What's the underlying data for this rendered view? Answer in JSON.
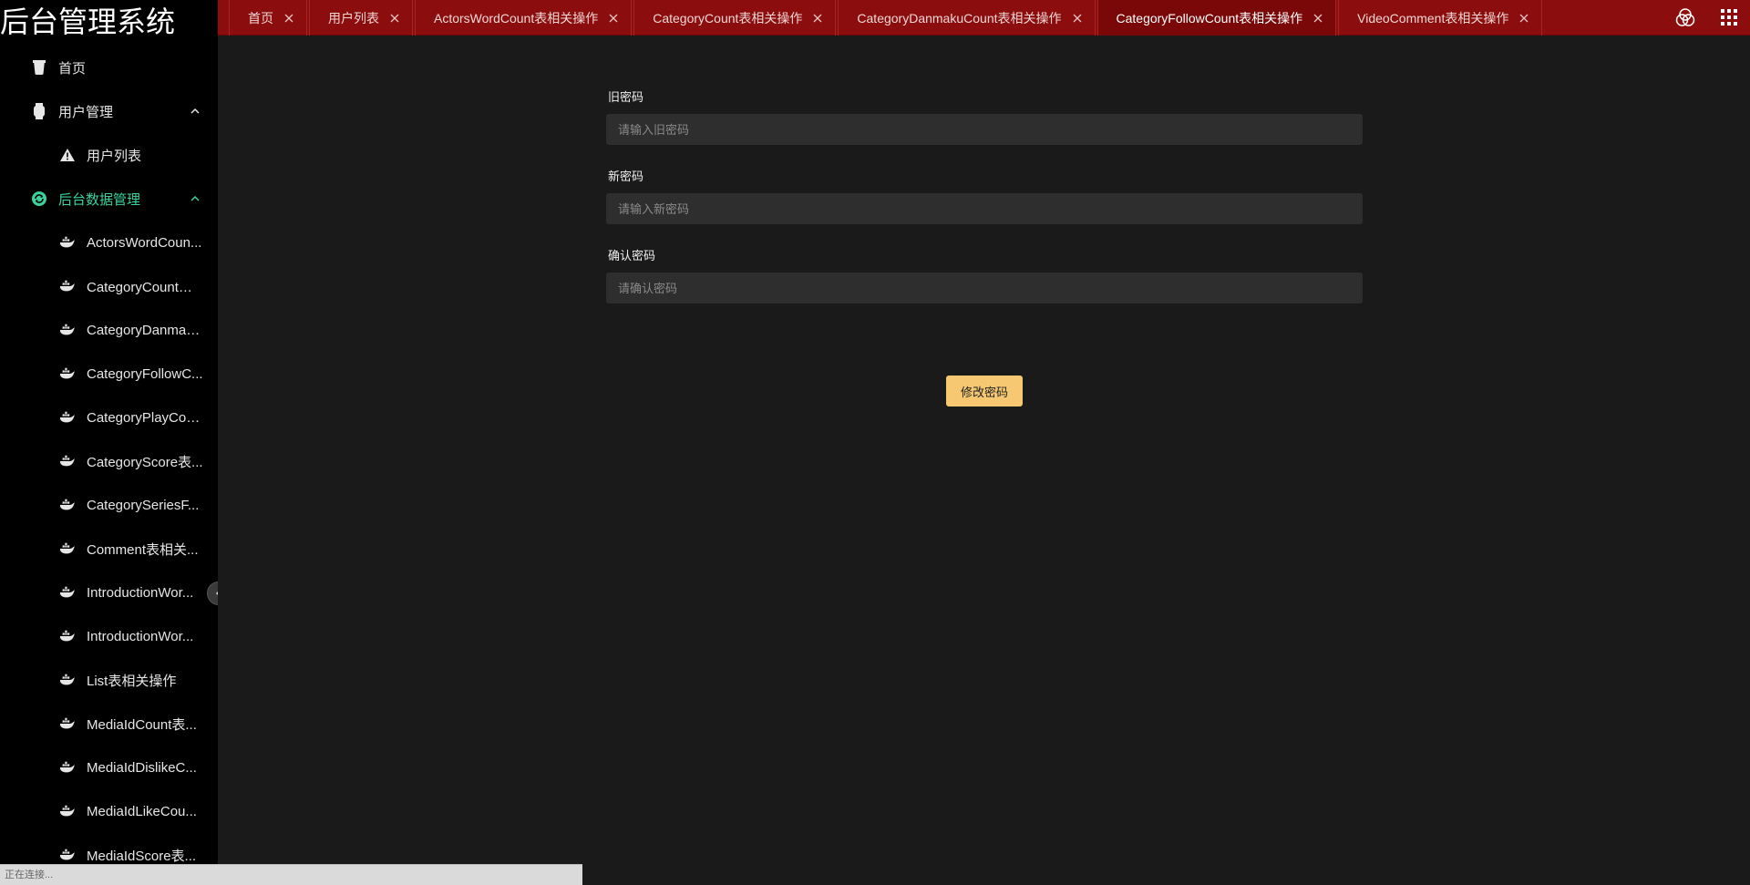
{
  "app": {
    "title": "后台管理系统"
  },
  "sidebar": {
    "home": {
      "label": "首页",
      "icon": "cup-icon"
    },
    "user_mgmt": {
      "label": "用户管理",
      "icon": "watch-icon",
      "expanded": true
    },
    "user_list": {
      "label": "用户列表",
      "icon": "warning-icon"
    },
    "data_mgmt": {
      "label": "后台数据管理",
      "icon": "refresh-icon",
      "expanded": true,
      "active": true
    },
    "items": [
      {
        "label": "ActorsWordCoun..."
      },
      {
        "label": "CategoryCount表..."
      },
      {
        "label": "CategoryDanmak..."
      },
      {
        "label": "CategoryFollowC..."
      },
      {
        "label": "CategoryPlayCou..."
      },
      {
        "label": "CategoryScore表..."
      },
      {
        "label": "CategorySeriesF..."
      },
      {
        "label": "Comment表相关..."
      },
      {
        "label": "IntroductionWor..."
      },
      {
        "label": "IntroductionWor..."
      },
      {
        "label": "List表相关操作"
      },
      {
        "label": "MediaIdCount表..."
      },
      {
        "label": "MediaIdDislikeC..."
      },
      {
        "label": "MediaIdLikeCou..."
      },
      {
        "label": "MediaIdScore表..."
      }
    ],
    "active_color": "#3ad3a0"
  },
  "tabs": [
    {
      "label": "首页"
    },
    {
      "label": "用户列表"
    },
    {
      "label": "ActorsWordCount表相关操作"
    },
    {
      "label": "CategoryCount表相关操作"
    },
    {
      "label": "CategoryDanmakuCount表相关操作"
    },
    {
      "label": "CategoryFollowCount表相关操作",
      "active": true
    },
    {
      "label": "VideoComment表相关操作"
    }
  ],
  "toolbar": {
    "theme_icon": "theme-circles-icon",
    "apps_icon": "grid-icon"
  },
  "form": {
    "old_password": {
      "label": "旧密码",
      "placeholder": "请输入旧密码",
      "value": ""
    },
    "new_password": {
      "label": "新密码",
      "placeholder": "请输入新密码",
      "value": ""
    },
    "confirm_password": {
      "label": "确认密码",
      "placeholder": "请确认密码",
      "value": ""
    },
    "submit_label": "修改密码"
  },
  "status": {
    "text": "正在连接..."
  },
  "colors": {
    "tabbar": "#8b0d0d",
    "button": "#f5c871",
    "sidebar": "#000000",
    "main": "#1a1a1a"
  }
}
